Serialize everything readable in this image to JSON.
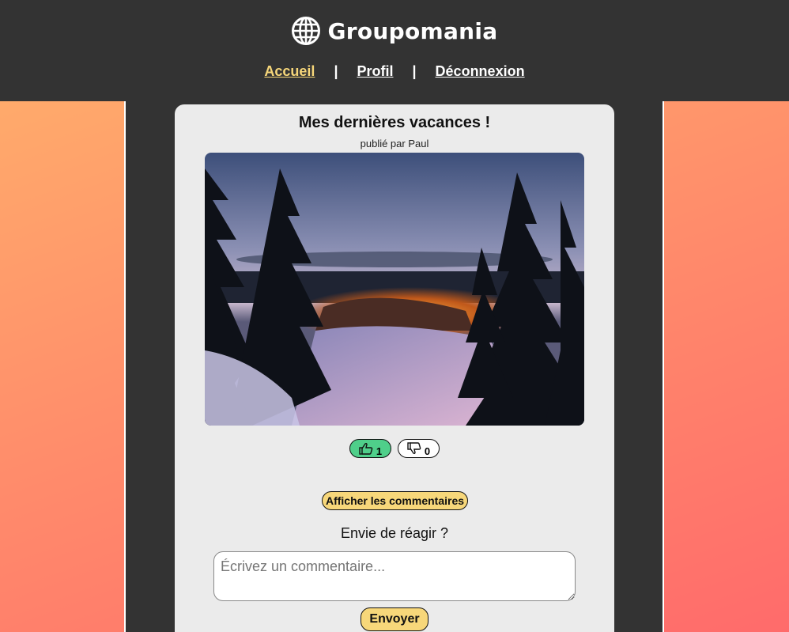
{
  "header": {
    "brand": "Groupomania",
    "brand_icon": "globe-icon",
    "nav": {
      "home": "Accueil",
      "profile": "Profil",
      "logout": "Déconnexion",
      "separator": "|"
    }
  },
  "post": {
    "title": "Mes dernières vacances !",
    "author": "publié par Paul",
    "image_icon": "winter-forest-photo",
    "likes": "1",
    "dislikes": "0",
    "like_icon": "thumbs-up-icon",
    "dislike_icon": "thumbs-down-icon",
    "show_comments": "Afficher les commentaires"
  },
  "comment_form": {
    "prompt": "Envie de réagir ?",
    "placeholder": "Écrivez un commentaire...",
    "submit": "Envoyer"
  },
  "colors": {
    "header_bg": "#333333",
    "accent_yellow": "#f7d77a",
    "like_green": "#4fcf8a",
    "gradient_start": "#ffb26b",
    "gradient_end": "#ff6b6b"
  }
}
